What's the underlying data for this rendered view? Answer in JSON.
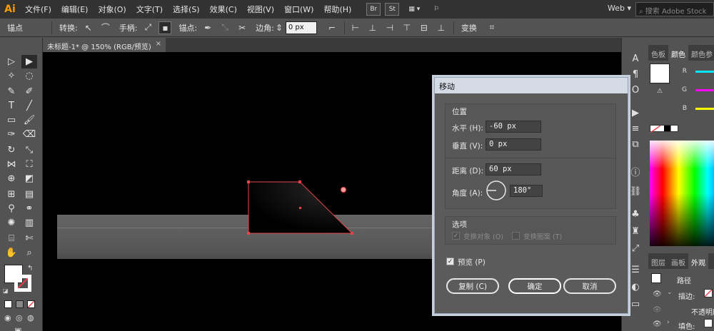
{
  "app": {
    "logo": "Ai"
  },
  "menu": [
    "文件(F)",
    "编辑(E)",
    "对象(O)",
    "文字(T)",
    "选择(S)",
    "效果(C)",
    "视图(V)",
    "窗口(W)",
    "帮助(H)"
  ],
  "menubar_icons": {
    "bridge": "Br",
    "stock": "St",
    "arrange": "▦ ▾",
    "gpu": "⚐"
  },
  "workspace": "Web",
  "search": {
    "placeholder": "搜索 Adobe Stock"
  },
  "control_bar": {
    "anchor_label": "锚点",
    "convert_label": "转换:",
    "handle_label": "手柄:",
    "anchor_points_label": "锚点:",
    "corner_label": "边角:",
    "corner_value": "0 px",
    "transform_label": "变换"
  },
  "document_tab": {
    "title": "未标题-1* @ 150% (RGB/预览)",
    "close": "×"
  },
  "right_panel": {
    "tabs_top": [
      "色板",
      "颜色",
      "颜色参"
    ],
    "active_top": "颜色",
    "sliders": [
      {
        "label": "R",
        "color": "#00e5ff"
      },
      {
        "label": "G",
        "color": "#ff00ff"
      },
      {
        "label": "B",
        "color": "#ffff00"
      }
    ],
    "tabs_bottom": [
      "图层",
      "画板",
      "外观"
    ],
    "active_bottom": "外观",
    "appearance": {
      "path_label": "路径",
      "stroke_label": "描边:",
      "opacity_label": "不透明度",
      "fill_label": "填色:"
    }
  },
  "dialog": {
    "title": "移动",
    "position_group": "位置",
    "horizontal_label": "水平 (H):",
    "horizontal_value": "-60 px",
    "vertical_label": "垂直 (V):",
    "vertical_value": "0 px",
    "distance_label": "距离 (D):",
    "distance_value": "60 px",
    "angle_label": "角度 (A):",
    "angle_value": "180°",
    "options_group": "选项",
    "transform_objects": "变换对象 (O)",
    "transform_patterns": "变换图案 (T)",
    "preview": "预览 (P)",
    "copy_button": "复制 (C)",
    "ok_button": "确定",
    "cancel_button": "取消"
  },
  "colors": {
    "selection": "#e8434a",
    "menubar": "#323232",
    "panel": "#535353",
    "dialog_title": "#d5dbe5"
  }
}
